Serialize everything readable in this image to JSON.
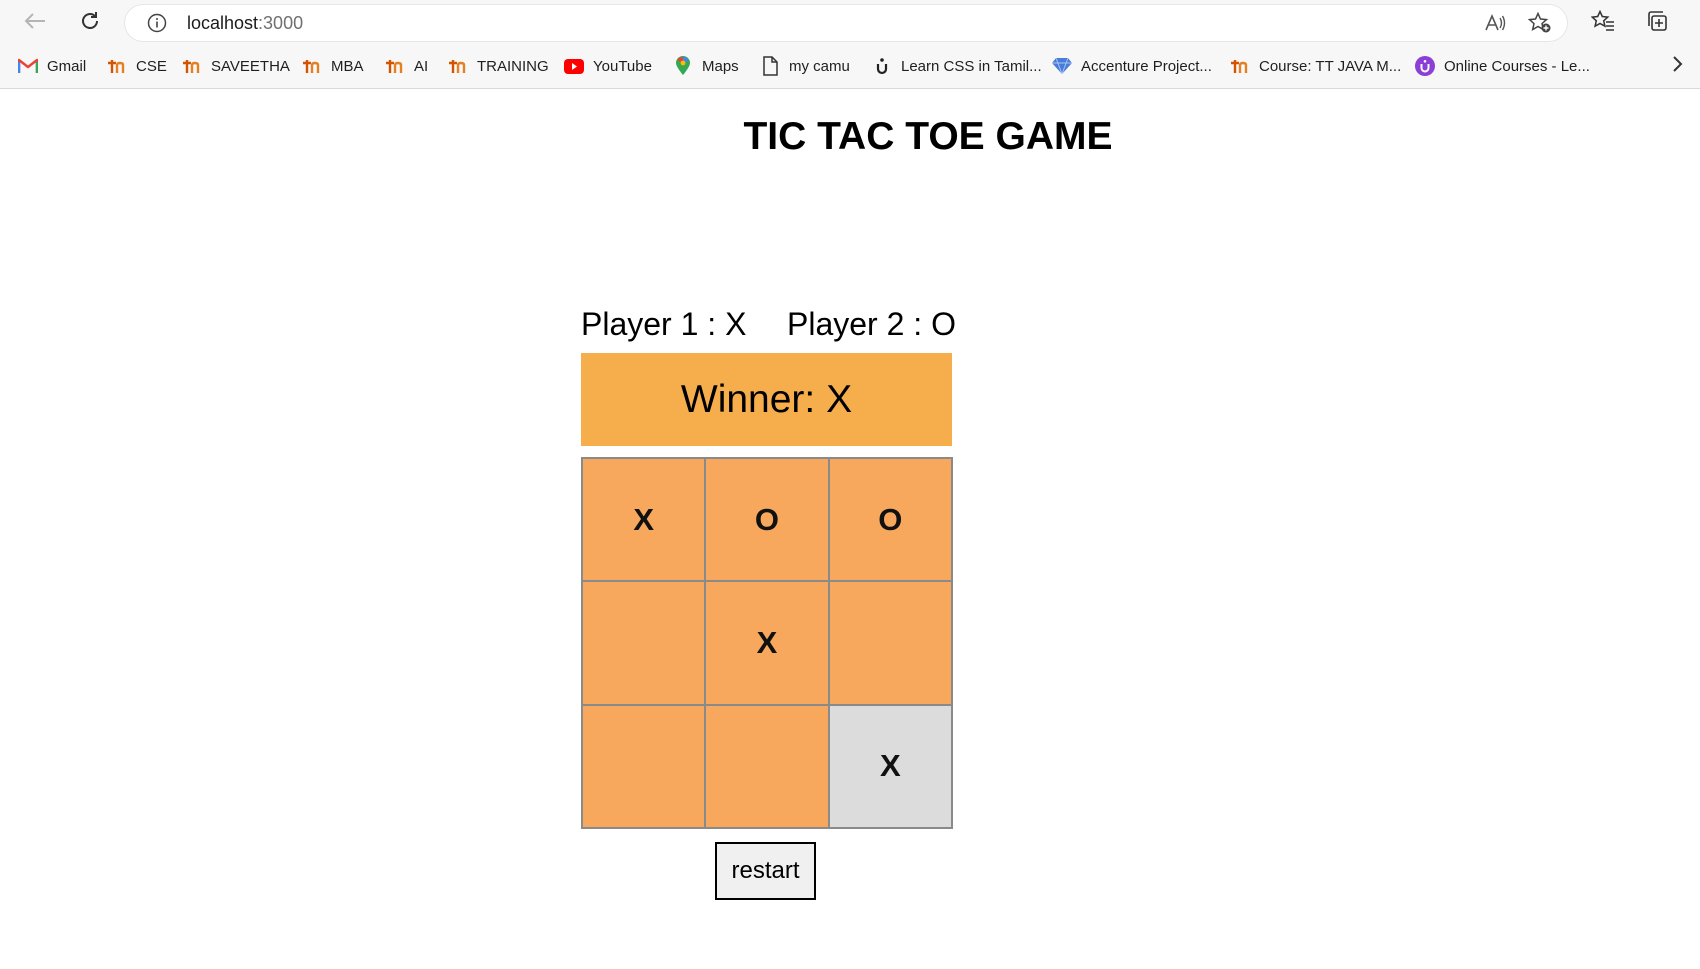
{
  "browser": {
    "url_host": "localhost",
    "url_rest": ":3000",
    "icons": {
      "back": "arrow-left-icon",
      "refresh": "refresh-icon",
      "info": "info-icon",
      "read_aloud": "read-aloud-icon",
      "add_favorite": "add-favorite-icon",
      "favorites": "favorites-icon",
      "collections": "collections-icon"
    }
  },
  "bookmarks": [
    {
      "label": "Gmail",
      "icon": "gmail-icon"
    },
    {
      "label": "CSE",
      "icon": "tn-logo-icon"
    },
    {
      "label": "SAVEETHA",
      "icon": "tn-logo-icon"
    },
    {
      "label": "MBA",
      "icon": "tn-logo-icon"
    },
    {
      "label": "AI",
      "icon": "tn-logo-icon"
    },
    {
      "label": "TRAINING",
      "icon": "tn-logo-icon"
    },
    {
      "label": "YouTube",
      "icon": "youtube-icon"
    },
    {
      "label": "Maps",
      "icon": "maps-pin-icon"
    },
    {
      "label": "my camu",
      "icon": "page-icon"
    },
    {
      "label": "Learn CSS in Tamil...",
      "icon": "u-logo-icon"
    },
    {
      "label": "Accenture Project...",
      "icon": "diamond-icon"
    },
    {
      "label": "Course: TT JAVA M...",
      "icon": "tn-logo-icon"
    },
    {
      "label": "Online Courses - Le...",
      "icon": "udemy-icon"
    }
  ],
  "page": {
    "title": "TIC TAC TOE GAME",
    "player1": "Player 1 : X",
    "player2": "Player 2 : O",
    "winner": "Winner: X",
    "board": [
      "X",
      "O",
      "O",
      "",
      "X",
      "",
      "",
      "",
      "X"
    ],
    "highlight_cell_index": 8,
    "restart_label": "restart"
  },
  "colors": {
    "winner_bg": "#f6ae4c",
    "cell_bg": "#f7a85d",
    "highlight_bg": "#dcdcdc"
  }
}
